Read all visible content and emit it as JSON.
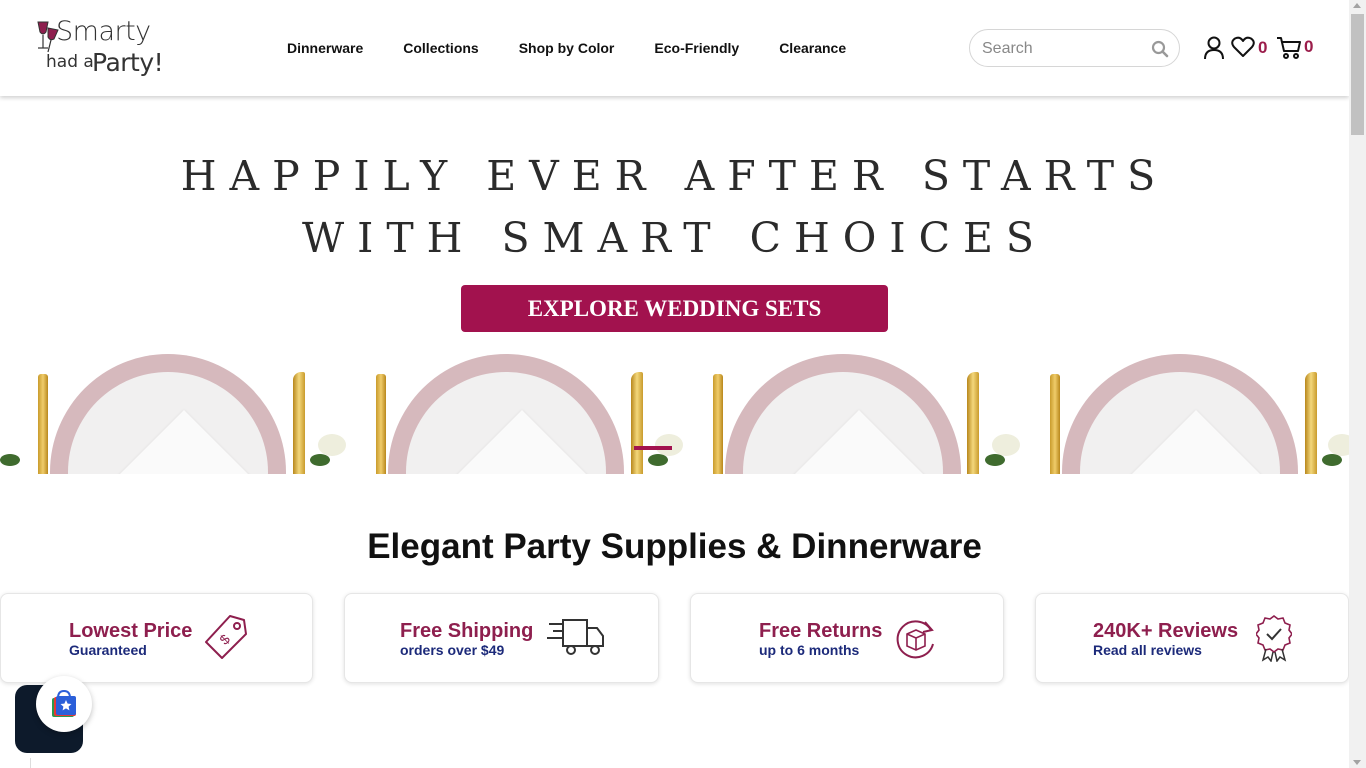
{
  "header": {
    "logo": {
      "line1": "Smarty",
      "line2": "had a",
      "line3": "Party!"
    },
    "nav": [
      "Dinnerware",
      "Collections",
      "Shop by Color",
      "Eco-Friendly",
      "Clearance"
    ],
    "search": {
      "placeholder": "Search",
      "value": ""
    },
    "wishlist_count": "0",
    "cart_count": "0"
  },
  "hero": {
    "line1": "HAPPILY EVER AFTER STARTS",
    "line2": "WITH SMART CHOICES",
    "button": "EXPLORE WEDDING SETS"
  },
  "section": {
    "title": "Elegant Party Supplies & Dinnerware"
  },
  "features": [
    {
      "title": "Lowest Price",
      "subtitle": "Guaranteed",
      "icon": "price-tag-icon"
    },
    {
      "title": "Free Shipping",
      "subtitle": "orders over $49",
      "icon": "truck-icon"
    },
    {
      "title": "Free Returns",
      "subtitle": "up to 6 months",
      "icon": "return-box-icon"
    },
    {
      "title": "240K+ Reviews",
      "subtitle": "Read all reviews",
      "icon": "award-ribbon-icon"
    }
  ],
  "colors": {
    "accent": "#a2124e",
    "feature_title": "#8e1f4e",
    "feature_sub": "#1c2a7a"
  }
}
